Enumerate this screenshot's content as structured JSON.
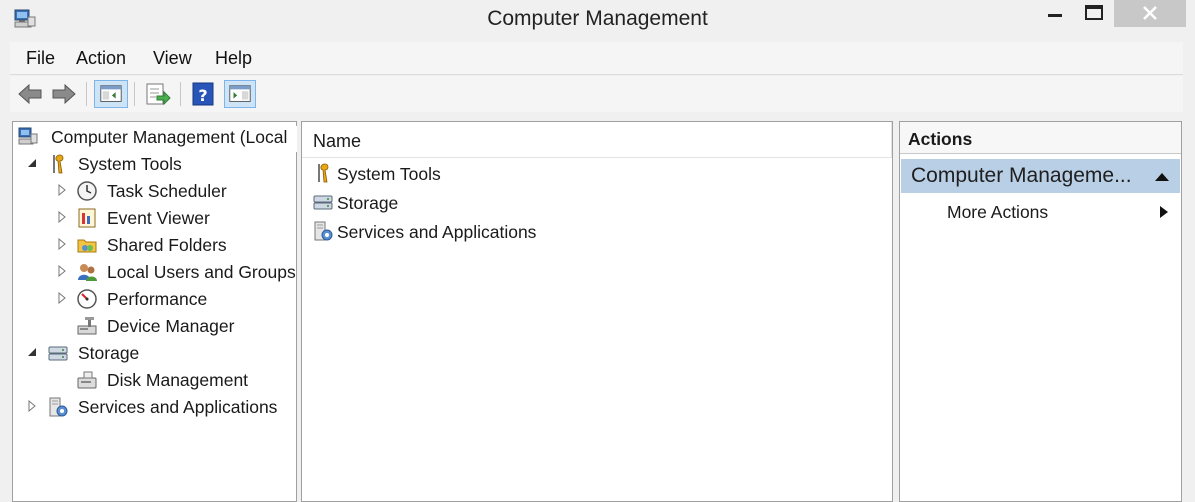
{
  "window": {
    "title": "Computer Management",
    "icon": "computer-management-icon"
  },
  "menu": {
    "items": [
      "File",
      "Action",
      "View",
      "Help"
    ]
  },
  "toolbar": {
    "buttons": [
      "back-arrow-icon",
      "forward-arrow-icon",
      "show-hide-console-tree-icon",
      "export-list-icon",
      "help-icon",
      "show-hide-action-pane-icon"
    ]
  },
  "tree": {
    "root": "Computer Management (Local",
    "system_tools": "System Tools",
    "task_scheduler": "Task Scheduler",
    "event_viewer": "Event Viewer",
    "shared_folders": "Shared Folders",
    "local_users": "Local Users and Groups",
    "performance": "Performance",
    "device_manager": "Device Manager",
    "storage": "Storage",
    "disk_management": "Disk Management",
    "services": "Services and Applications"
  },
  "list": {
    "column_name": "Name",
    "items": [
      "System Tools",
      "Storage",
      "Services and Applications"
    ]
  },
  "actions": {
    "title": "Actions",
    "group": "Computer Manageme...",
    "more": "More Actions"
  },
  "colors": {
    "selection": "#b9cfe6",
    "pressed": "#cde4f7",
    "close_hover": "#c8c8c8"
  }
}
